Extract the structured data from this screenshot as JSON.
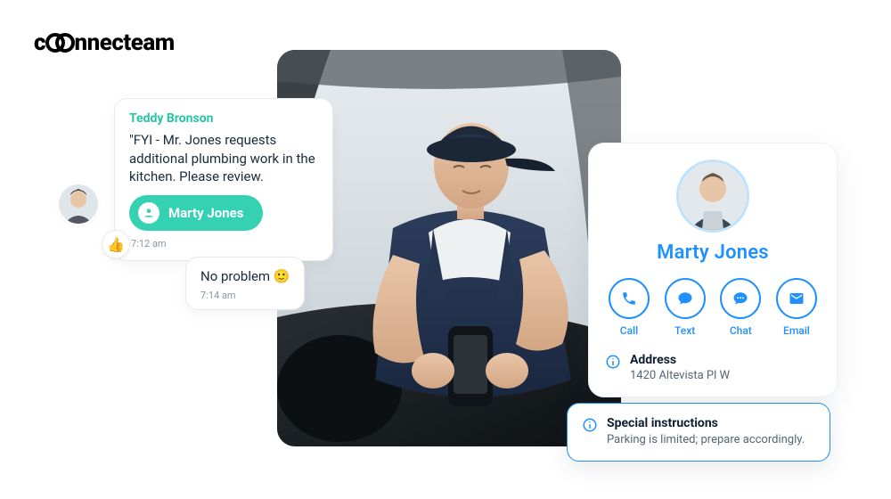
{
  "brand": {
    "name": "connecteam"
  },
  "chat": {
    "sender": "Teddy Bronson",
    "message": "\"FYI - Mr. Jones requests additional plumbing work in the kitchen. Please review.",
    "chip_label": "Marty Jones",
    "timestamp_1": "7:12 am",
    "reply": "No problem 🙂",
    "timestamp_2": "7:14 am",
    "reaction": "👍"
  },
  "contact": {
    "name": "Marty Jones",
    "actions": {
      "call": "Call",
      "text": "Text",
      "chat": "Chat",
      "email": "Email"
    },
    "address_label": "Address",
    "address_value": "1420 Altevista Pl W"
  },
  "callout": {
    "title": "Special instructions",
    "body": "Parking is limited; prepare accordingly."
  },
  "colors": {
    "accent": "#1e90ff",
    "teal": "#34d1b2"
  }
}
